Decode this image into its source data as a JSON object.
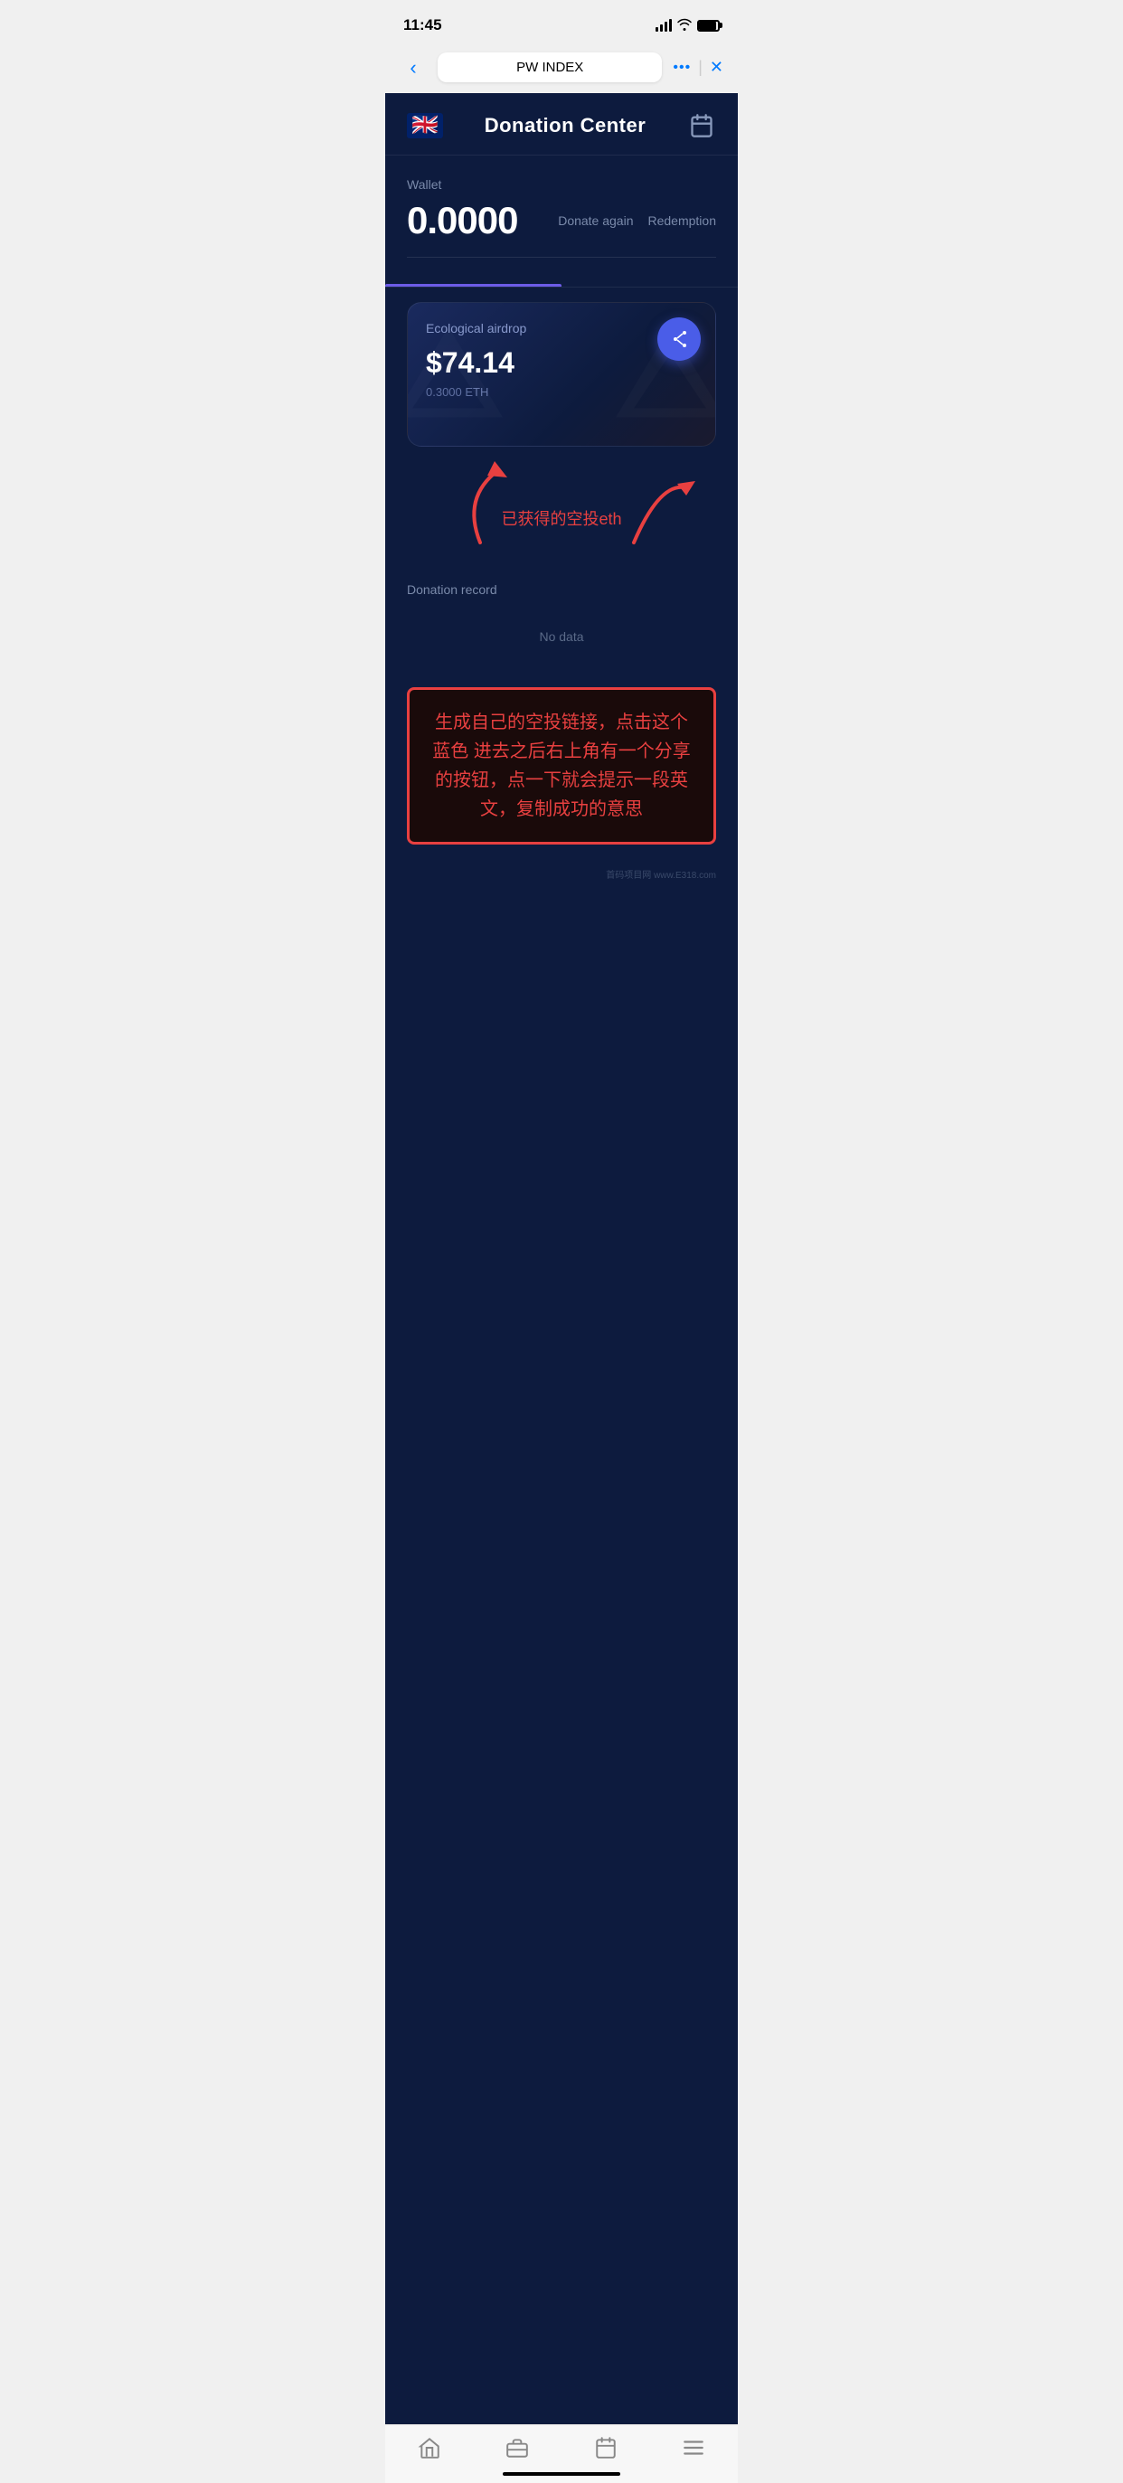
{
  "statusBar": {
    "time": "11:45",
    "batteryLevel": 90
  },
  "browserNav": {
    "title": "PW INDEX",
    "dotsLabel": "•••",
    "closeLabel": "✕",
    "backLabel": "‹"
  },
  "appHeader": {
    "title": "Donation Center",
    "flagEmoji": "🇬🇧",
    "calendarAriaLabel": "Calendar"
  },
  "wallet": {
    "label": "Wallet",
    "amount": "0.0000",
    "donateAgainLabel": "Donate again",
    "redemptionLabel": "Redemption"
  },
  "tabs": [
    {
      "label": "",
      "active": true
    },
    {
      "label": "",
      "active": false
    }
  ],
  "card": {
    "type": "Ecological airdrop",
    "amountUSD": "$74.14",
    "amountETH": "0.3000 ETH",
    "shareIconLabel": "share-network-icon"
  },
  "donationRecord": {
    "label": "Donation record",
    "noDataText": "No data"
  },
  "annotationArrow1": "已获得的空投eth",
  "annotationBox": {
    "text": "生成自己的空投链接，点击这个蓝色 进去之后右上角有一个分享的按钮，点一下就会提示一段英文，复制成功的意思"
  },
  "bottomNav": {
    "homeIcon": "🏠",
    "briefcaseIcon": "💼",
    "calendarIcon": "📅",
    "menuIcon": "☰"
  },
  "watermark": {
    "text": "首码项目网 www.E318.com"
  }
}
